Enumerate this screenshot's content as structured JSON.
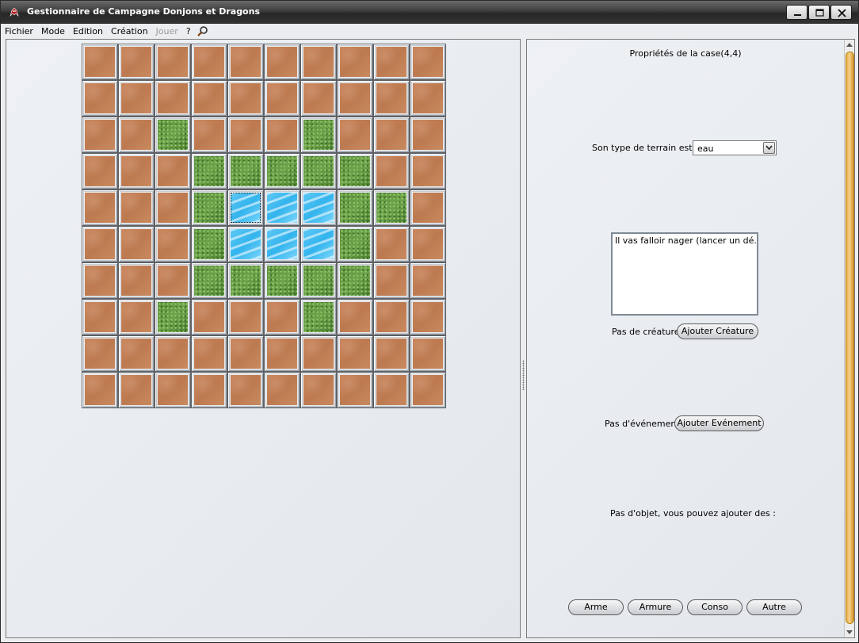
{
  "window": {
    "title": "Gestionnaire de Campagne Donjons et Dragons"
  },
  "menu": {
    "items": [
      {
        "label": "Fichier",
        "enabled": true
      },
      {
        "label": "Mode",
        "enabled": true
      },
      {
        "label": "Edition",
        "enabled": true
      },
      {
        "label": "Création",
        "enabled": true
      },
      {
        "label": "Jouer",
        "enabled": false
      },
      {
        "label": "?",
        "enabled": true
      }
    ],
    "search_icon": "magnifier-icon"
  },
  "map": {
    "rows": 10,
    "cols": 10,
    "selected": [
      4,
      4
    ],
    "terrain_colors": {
      "terre": "#c4805a",
      "herbe": "#5f943f",
      "eau": "#3fbcf0"
    },
    "grid": [
      [
        "terre",
        "terre",
        "terre",
        "terre",
        "terre",
        "terre",
        "terre",
        "terre",
        "terre",
        "terre"
      ],
      [
        "terre",
        "terre",
        "terre",
        "terre",
        "terre",
        "terre",
        "terre",
        "terre",
        "terre",
        "terre"
      ],
      [
        "terre",
        "terre",
        "herbe",
        "terre",
        "terre",
        "terre",
        "herbe",
        "terre",
        "terre",
        "terre"
      ],
      [
        "terre",
        "terre",
        "terre",
        "herbe",
        "herbe",
        "herbe",
        "herbe",
        "herbe",
        "terre",
        "terre"
      ],
      [
        "terre",
        "terre",
        "terre",
        "herbe",
        "eau",
        "eau",
        "eau",
        "herbe",
        "herbe",
        "terre"
      ],
      [
        "terre",
        "terre",
        "terre",
        "herbe",
        "eau",
        "eau",
        "eau",
        "herbe",
        "terre",
        "terre"
      ],
      [
        "terre",
        "terre",
        "terre",
        "herbe",
        "herbe",
        "herbe",
        "herbe",
        "herbe",
        "terre",
        "terre"
      ],
      [
        "terre",
        "terre",
        "herbe",
        "terre",
        "terre",
        "terre",
        "herbe",
        "terre",
        "terre",
        "terre"
      ],
      [
        "terre",
        "terre",
        "terre",
        "terre",
        "terre",
        "terre",
        "terre",
        "terre",
        "terre",
        "terre"
      ],
      [
        "terre",
        "terre",
        "terre",
        "terre",
        "terre",
        "terre",
        "terre",
        "terre",
        "terre",
        "terre"
      ]
    ]
  },
  "properties": {
    "title": "Propriétés de la case(4,4)",
    "terrain_label": "Son type de terrain est :",
    "terrain_value": "eau",
    "description": "Il vas falloir nager (lancer un dé...)",
    "creature_label": "Pas de créature",
    "add_creature_button": "Ajouter Créature",
    "event_label": "Pas d'événement",
    "add_event_button": "Ajouter Evénement",
    "object_label": "Pas d'objet, vous pouvez ajouter des :",
    "object_buttons": [
      "Arme",
      "Armure",
      "Conso",
      "Autre"
    ]
  },
  "colors": {
    "scroll_thumb": "#e8a94a",
    "title_bar": "#333333"
  }
}
